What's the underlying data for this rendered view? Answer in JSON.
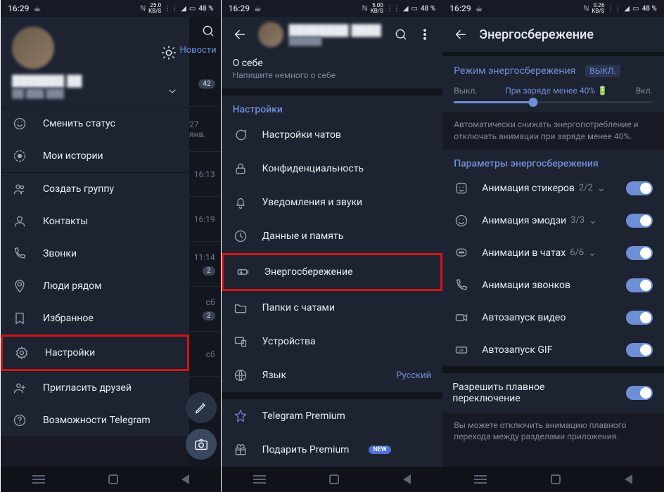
{
  "status": {
    "time": "16:29",
    "net1": "25.0",
    "net2": "5.00",
    "net3": "0.26",
    "kbs": "KB/S",
    "bat": "48 %"
  },
  "screen1": {
    "items": [
      "Сменить статус",
      "Мои истории",
      "Создать группу",
      "Контакты",
      "Звонки",
      "Люди рядом",
      "Избранное",
      "Настройки",
      "Пригласить друзей",
      "Возможности Telegram"
    ],
    "slice": {
      "news": "Новости",
      "badge42": "42",
      "date": "27 янв.",
      "t1": "16:13",
      "t2": "16:19",
      "t3": "11:14",
      "b2": "2",
      "b3": "2",
      "sb1": "сб",
      "sb2": "сб"
    }
  },
  "screen2": {
    "about_title": "О себе",
    "about_sub": "Напишите немного о себе",
    "settings_hdr": "Настройки",
    "items": [
      "Настройки чатов",
      "Конфиденциальность",
      "Уведомления и звуки",
      "Данные и память",
      "Энергосбережение",
      "Папки с чатами",
      "Устройства",
      "Язык"
    ],
    "lang_val": "Русский",
    "premium": "Telegram Premium",
    "gift": "Подарить Premium",
    "new": "NEW"
  },
  "screen3": {
    "title": "Энергосбережение",
    "mode_label": "Режим энергосбережения",
    "mode_status": "ВЫКЛ.",
    "sl_off": "Выкл.",
    "sl_mid": "При заряде менее 40%",
    "sl_on": "Вкл.",
    "desc": "Автоматически снижать энергопотребление и отключать анимации при заряде менее 40%.",
    "params_hdr": "Параметры энергосбережения",
    "rows": [
      {
        "label": "Анимация стикеров",
        "frac": "2/2"
      },
      {
        "label": "Анимация эмодзи",
        "frac": "3/3"
      },
      {
        "label": "Анимации в чатах",
        "frac": "6/6"
      },
      {
        "label": "Анимации звонков",
        "frac": ""
      },
      {
        "label": "Автозапуск видео",
        "frac": ""
      },
      {
        "label": "Автозапуск GIF",
        "frac": ""
      }
    ],
    "smooth": "Разрешить плавное переключение",
    "smooth_desc": "Вы можете отключить анимацию плавного перехода между разделами приложения."
  }
}
